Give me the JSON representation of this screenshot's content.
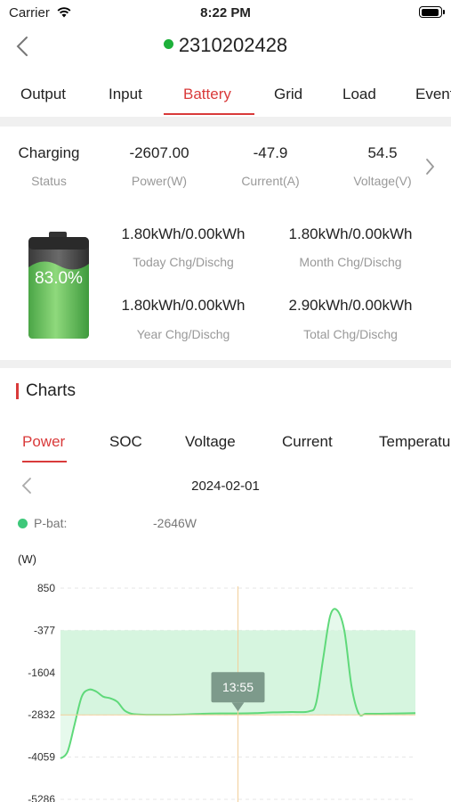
{
  "status_bar": {
    "carrier": "Carrier",
    "time": "8:22 PM"
  },
  "header": {
    "device_id": "2310202428",
    "status_color": "#1db03a"
  },
  "tabs": [
    {
      "label": "Output",
      "active": false
    },
    {
      "label": "Input",
      "active": false
    },
    {
      "label": "Battery",
      "active": true
    },
    {
      "label": "Grid",
      "active": false
    },
    {
      "label": "Load",
      "active": false
    },
    {
      "label": "Event",
      "active": false
    }
  ],
  "summary": {
    "stats": [
      {
        "value": "Charging",
        "label": "Status"
      },
      {
        "value": "-2607.00",
        "label": "Power(W)"
      },
      {
        "value": "-47.9",
        "label": "Current(A)"
      },
      {
        "value": "54.5",
        "label": "Voltage(V)"
      }
    ],
    "soc": "83.0%",
    "soc_fraction": 0.83,
    "energy": [
      {
        "value": "1.80kWh/0.00kWh",
        "label": "Today Chg/Dischg"
      },
      {
        "value": "1.80kWh/0.00kWh",
        "label": "Month Chg/Dischg"
      },
      {
        "value": "1.80kWh/0.00kWh",
        "label": "Year Chg/Dischg"
      },
      {
        "value": "2.90kWh/0.00kWh",
        "label": "Total Chg/Dischg"
      }
    ]
  },
  "charts": {
    "title": "Charts",
    "tabs": [
      {
        "label": "Power",
        "active": true
      },
      {
        "label": "SOC",
        "active": false
      },
      {
        "label": "Voltage",
        "active": false
      },
      {
        "label": "Current",
        "active": false
      },
      {
        "label": "Temperature",
        "active": false
      }
    ],
    "date": "2024-02-01",
    "legend_name": "P-bat:",
    "legend_value": "-2646W",
    "tooltip": "13:55",
    "accent_color": "#d93a3a",
    "line_color": "#5fd97a",
    "fill_color": "#d6f5df"
  },
  "chart_data": {
    "type": "area",
    "ylabel": "(W)",
    "yticks": [
      "850",
      "-377",
      "-1604",
      "-2832",
      "-4059",
      "-5286"
    ],
    "ylim": [
      -5286,
      850
    ],
    "x_fraction": [
      0.0,
      0.02,
      0.04,
      0.06,
      0.08,
      0.1,
      0.12,
      0.14,
      0.16,
      0.18,
      0.2,
      0.22,
      0.25,
      0.28,
      0.31,
      0.35,
      0.4,
      0.45,
      0.5,
      0.55,
      0.6,
      0.65,
      0.7,
      0.72,
      0.74,
      0.76,
      0.78,
      0.8,
      0.82,
      0.84,
      0.86,
      0.88,
      0.9,
      0.95,
      1.0
    ],
    "values": [
      -4100,
      -3900,
      -3100,
      -2300,
      -2100,
      -2150,
      -2300,
      -2350,
      -2450,
      -2700,
      -2800,
      -2820,
      -2830,
      -2830,
      -2830,
      -2820,
      -2800,
      -2790,
      -2790,
      -2780,
      -2760,
      -2750,
      -2730,
      -2500,
      -1200,
      50,
      200,
      -400,
      -2000,
      -2790,
      -2800,
      -2800,
      -2800,
      -2790,
      -2780
    ],
    "shaded_band": [
      -2832,
      -377
    ],
    "crosshair_time": "13:55",
    "crosshair_value": -2832,
    "crosshair_x_fraction": 0.5
  }
}
